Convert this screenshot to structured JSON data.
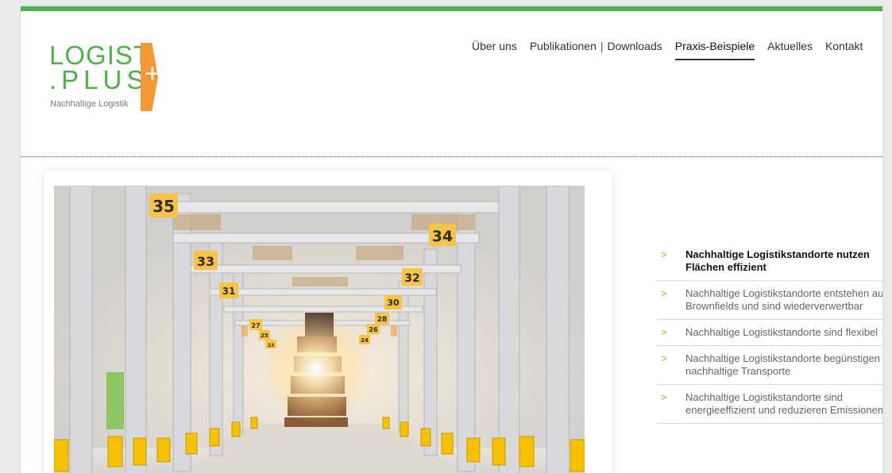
{
  "colors": {
    "brand_green": "#4fb249",
    "brand_orange": "#f39a36",
    "nav_text": "#333333",
    "active_underline": "#333333"
  },
  "logo": {
    "line1": "LOGIST",
    "line2": ".PLUS",
    "plus": "+",
    "tagline": "Nachhaltige Logistik"
  },
  "nav": {
    "items": [
      {
        "label": "Über uns",
        "active": false
      },
      {
        "label": "Publikationen",
        "active": false
      },
      {
        "label": "Downloads",
        "active": false
      },
      {
        "label": "Praxis-Beispiele",
        "active": true
      },
      {
        "label": "Aktuelles",
        "active": false
      },
      {
        "label": "Kontakt",
        "active": false
      }
    ],
    "separator": "|"
  },
  "hero": {
    "shelf_labels": [
      "35",
      "34",
      "33",
      "32",
      "31",
      "30",
      "28",
      "27",
      "26",
      "25",
      "24",
      "23"
    ]
  },
  "sidebar": {
    "icon": "chevron-right-icon",
    "items": [
      {
        "label": "Nachhaltige Logistikstandorte nutzen Flächen effizient",
        "active": true
      },
      {
        "label": "Nachhaltige Logistikstandorte entstehen auf Brownfields und sind wiederverwertbar",
        "active": false
      },
      {
        "label": "Nachhaltige Logistikstandorte sind flexibel",
        "active": false
      },
      {
        "label": "Nachhaltige Logistikstandorte begünstigen nachhaltige Transporte",
        "active": false
      },
      {
        "label": "Nachhaltige Logistikstandorte sind energieeffizient und reduzieren Emissionen",
        "active": false
      }
    ]
  }
}
